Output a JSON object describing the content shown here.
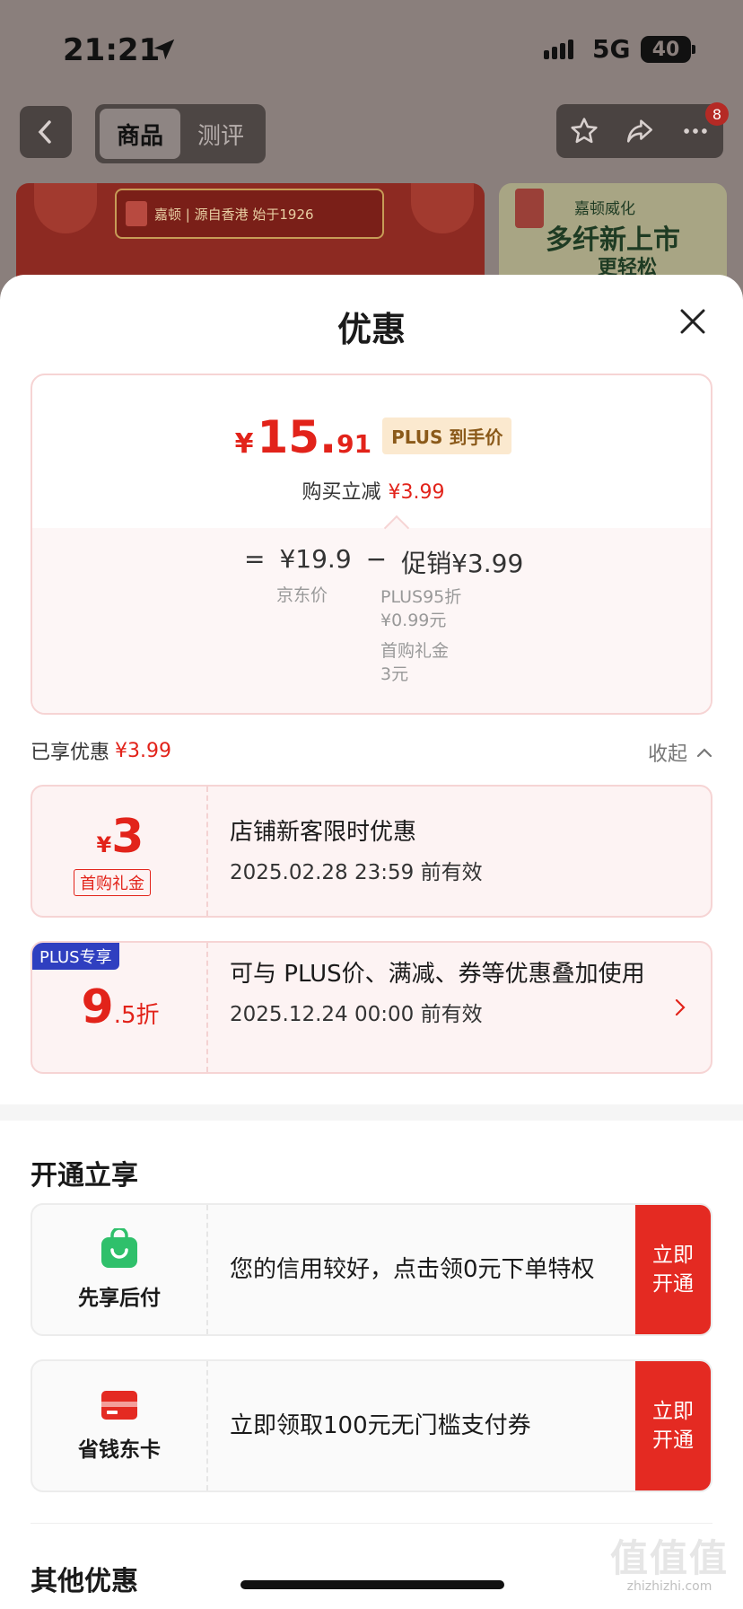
{
  "status_bar": {
    "time": "21:21",
    "network": "5G",
    "battery": "40"
  },
  "nav": {
    "tabs": [
      {
        "label": "商品"
      },
      {
        "label": "测评"
      }
    ],
    "badge": "8"
  },
  "banners": {
    "left_text": "嘉顿 | 源自香港 始于1926",
    "right_line1": "嘉顿威化",
    "right_line2": "多纤新上市",
    "right_line3": "更轻松"
  },
  "sheet": {
    "title": "优惠",
    "price": {
      "yen": "¥",
      "integer": "15.",
      "decimal": "91",
      "tag": "PLUS 到手价",
      "reduce_label": "购买立减",
      "reduce_value": "¥3.99"
    },
    "breakdown": {
      "eq": "=",
      "base": "¥19.9",
      "minus": "−",
      "promo": "促销¥3.99",
      "base_label": "京东价",
      "promo_line1": "PLUS95折",
      "promo_line2": "¥0.99元",
      "promo_line3": "首购礼金",
      "promo_line4": "3元"
    },
    "enjoyed": {
      "label": "已享优惠",
      "value": "¥3.99",
      "collapse": "收起"
    },
    "coupons": [
      {
        "amount_prefix": "¥",
        "amount": "3",
        "tag": "首购礼金",
        "title": "店铺新客限时优惠",
        "date": "2025.02.28 23:59 前有效"
      },
      {
        "badge": "PLUS专享",
        "amount": "9",
        "amount_suffix": ".5折",
        "title": "可与 PLUS价、满减、券等优惠叠加使用",
        "date": "2025.12.24 00:00 前有效"
      }
    ],
    "activate": {
      "title": "开通立享",
      "items": [
        {
          "label": "先享后付",
          "desc": "您的信用较好，点击领0元下单特权",
          "button": "立即开通"
        },
        {
          "label": "省钱东卡",
          "desc": "立即领取100元无门槛支付券",
          "button": "立即开通"
        }
      ]
    },
    "other_title": "其他优惠"
  },
  "watermark": {
    "big": "值值值",
    "small": "zhizhizhi.com"
  }
}
